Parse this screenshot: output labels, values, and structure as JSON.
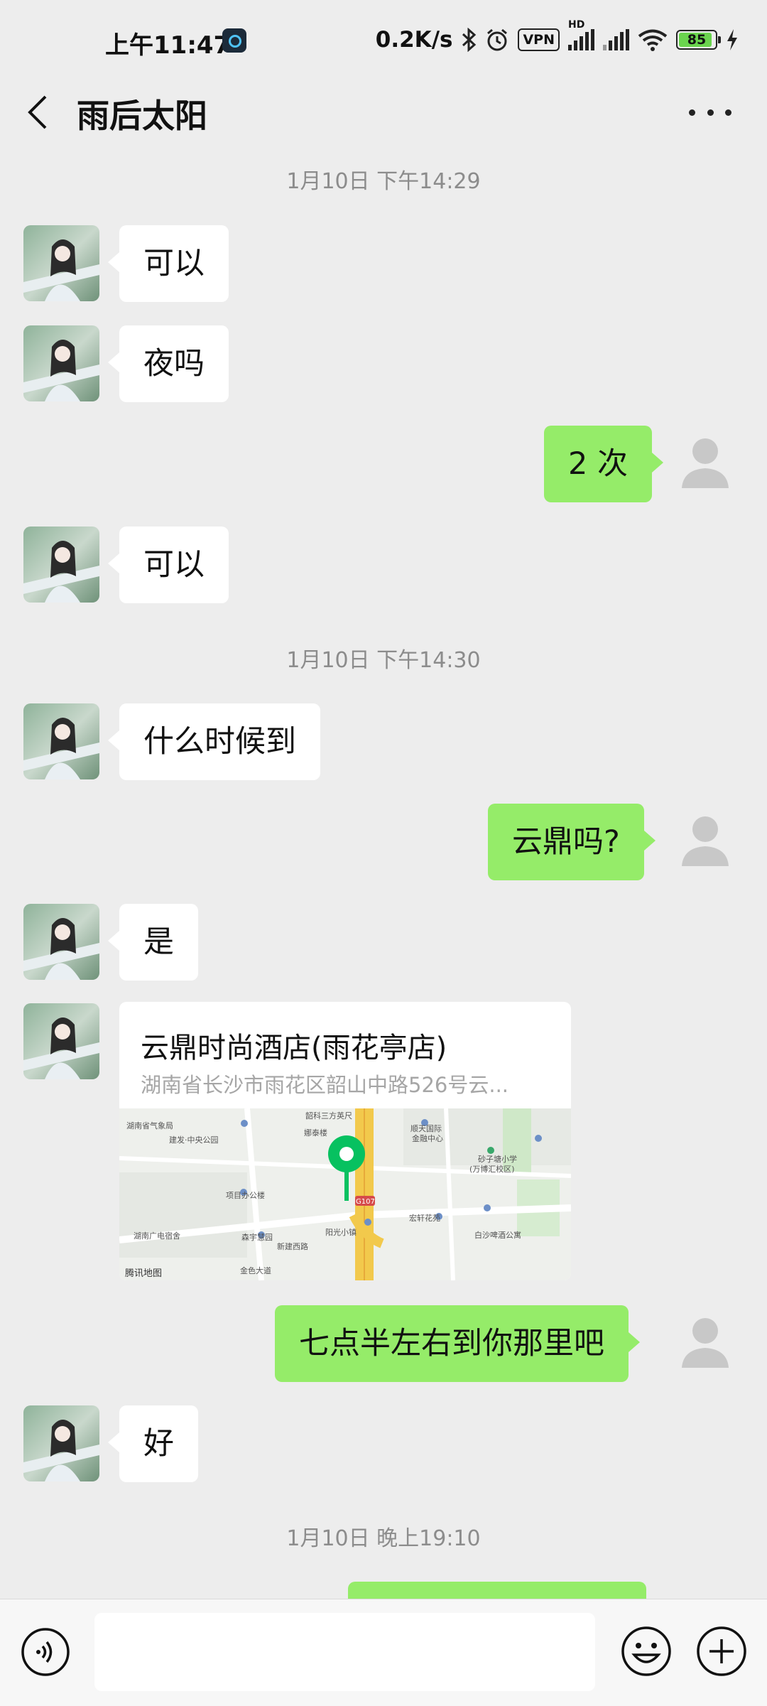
{
  "status_bar": {
    "time": "上午11:47",
    "net_speed": "0.2K/s",
    "vpn_label": "VPN",
    "hd_label": "HD",
    "battery": "85",
    "icons": [
      "bluetooth-icon",
      "alarm-icon",
      "vpn-icon",
      "signal-icon",
      "wifi-icon",
      "battery-icon",
      "charging-icon"
    ]
  },
  "header": {
    "title": "雨后太阳",
    "back_icon": "chevron-left-icon",
    "more_icon": "more-icon"
  },
  "messages": [
    {
      "type": "time",
      "text": "1月10日 下午14:29"
    },
    {
      "type": "in",
      "text": "可以"
    },
    {
      "type": "in",
      "text": "夜吗"
    },
    {
      "type": "out",
      "text": "2 次"
    },
    {
      "type": "in",
      "text": "可以"
    },
    {
      "type": "time",
      "text": "1月10日 下午14:30"
    },
    {
      "type": "in",
      "text": "什么时候到"
    },
    {
      "type": "out",
      "text": "云鼎吗?"
    },
    {
      "type": "in",
      "text": "是"
    },
    {
      "type": "location",
      "name": "云鼎时尚酒店(雨花亭店)",
      "address": "湖南省长沙市雨花区韶山中路526号云...",
      "map_labels": [
        "韶科三方英尺",
        "顺天国际金融中心",
        "湖南省气象局",
        "建发·中央公园",
        "项目办公楼",
        "湖南广电宿舍",
        "森宇慧园",
        "新建西路",
        "阳光小镇",
        "宏轩花苑",
        "砂子塘小学(万博汇校区)",
        "白沙啤酒公寓",
        "金色大道",
        "G107",
        "腾讯地图"
      ]
    },
    {
      "type": "out",
      "text": "七点半左右到你那里吧"
    },
    {
      "type": "in",
      "text": "好"
    },
    {
      "type": "time",
      "text": "1月10日 晚上19:10"
    }
  ],
  "input_bar": {
    "voice_icon": "voice-icon",
    "placeholder": "",
    "emoji_icon": "emoji-icon",
    "plus_icon": "plus-icon"
  },
  "colors": {
    "background": "#ededed",
    "out_bubble": "#95ec69",
    "in_bubble": "#ffffff",
    "map_pin": "#07c160"
  }
}
